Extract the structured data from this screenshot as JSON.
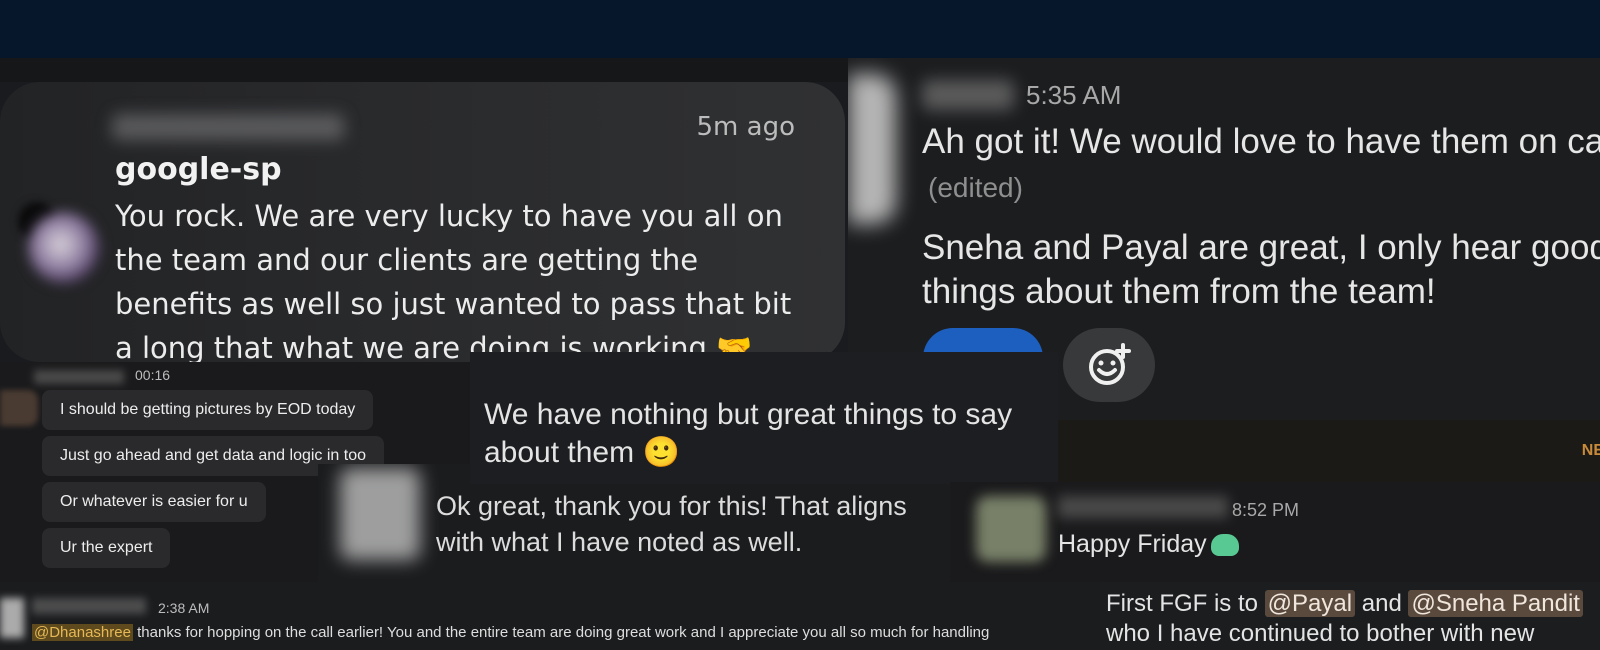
{
  "notification": {
    "time": "5m ago",
    "sender": "google-sp",
    "body": "You rock. We are very lucky to have you all on the team and our clients are getting the benefits as well so just wanted to pass that bit a long that what we are doing is working 🤝"
  },
  "slack_message": {
    "time": "5:35 AM",
    "line1": "Ah got it! We would love to have them on call!",
    "edited": "(edited)",
    "line2": "Sneha and Payal are great, I only hear good things about them from the team!",
    "add_reaction_icon": "add-reaction-icon"
  },
  "chat": {
    "time": "00:16",
    "messages": [
      "I should be getting pictures by EOD today",
      "Just go ahead and get data and logic in too",
      "Or whatever is easier for u",
      "Ur the expert"
    ]
  },
  "overlay_quote": {
    "text": "We have nothing but great things to say about them 🙂"
  },
  "reply": {
    "text": "Ok great, thank you for this! That aligns with what I have noted as well."
  },
  "new_divider": {
    "label": "NE"
  },
  "friday_message": {
    "time": "8:52 PM",
    "text": "Happy Friday"
  },
  "bottom_message": {
    "time": "2:38 AM",
    "mention": "@Dhanashree",
    "text": " thanks for hopping on the call earlier! You and the entire team are doing great work and I appreciate you all so much for handling"
  },
  "fgf_message": {
    "prefix": "First FGF is to ",
    "mention1": "@Payal",
    "middle": " and ",
    "mention2": "@Sneha Pandit",
    "line2": "who I have continued to bother with new"
  }
}
